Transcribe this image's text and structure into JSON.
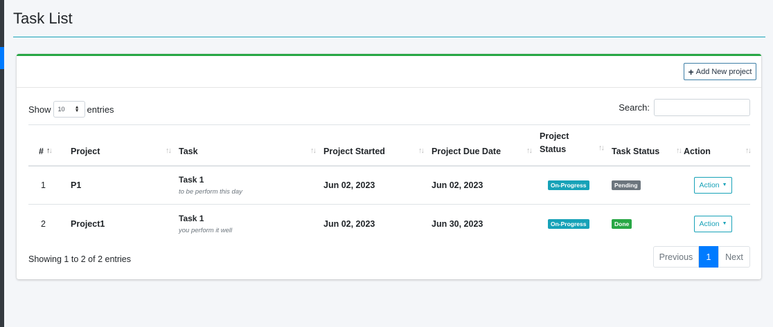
{
  "page": {
    "title": "Task List"
  },
  "card": {
    "add_button_label": "Add New project"
  },
  "controls": {
    "show_label": "Show",
    "entries_label": "entries",
    "page_length": "10",
    "search_label": "Search:",
    "search_value": ""
  },
  "table": {
    "headers": [
      "#",
      "Project",
      "Task",
      "Project Started",
      "Project Due Date",
      "Project Status",
      "Task Status",
      "Action"
    ],
    "rows": [
      {
        "num": "1",
        "project": "P1",
        "task": "Task 1",
        "task_desc": "to be perform this day",
        "started": "Jun 02, 2023",
        "due": "Jun 02, 2023",
        "project_status": "On-Progress",
        "task_status": "Pending",
        "action": "Action"
      },
      {
        "num": "2",
        "project": "Project1",
        "task": "Task 1",
        "task_desc": "you perform it well",
        "started": "Jun 02, 2023",
        "due": "Jun 30, 2023",
        "project_status": "On-Progress",
        "task_status": "Done",
        "action": "Action"
      }
    ]
  },
  "footer": {
    "info": "Showing 1 to 2 of 2 entries",
    "previous": "Previous",
    "current_page": "1",
    "next": "Next"
  },
  "colors": {
    "card_top_border": "#28a745",
    "header_rule": "#17a2b8",
    "on_progress": "#17a2b8",
    "pending": "#6c757d",
    "done": "#28a745",
    "pager_active": "#007bff"
  }
}
